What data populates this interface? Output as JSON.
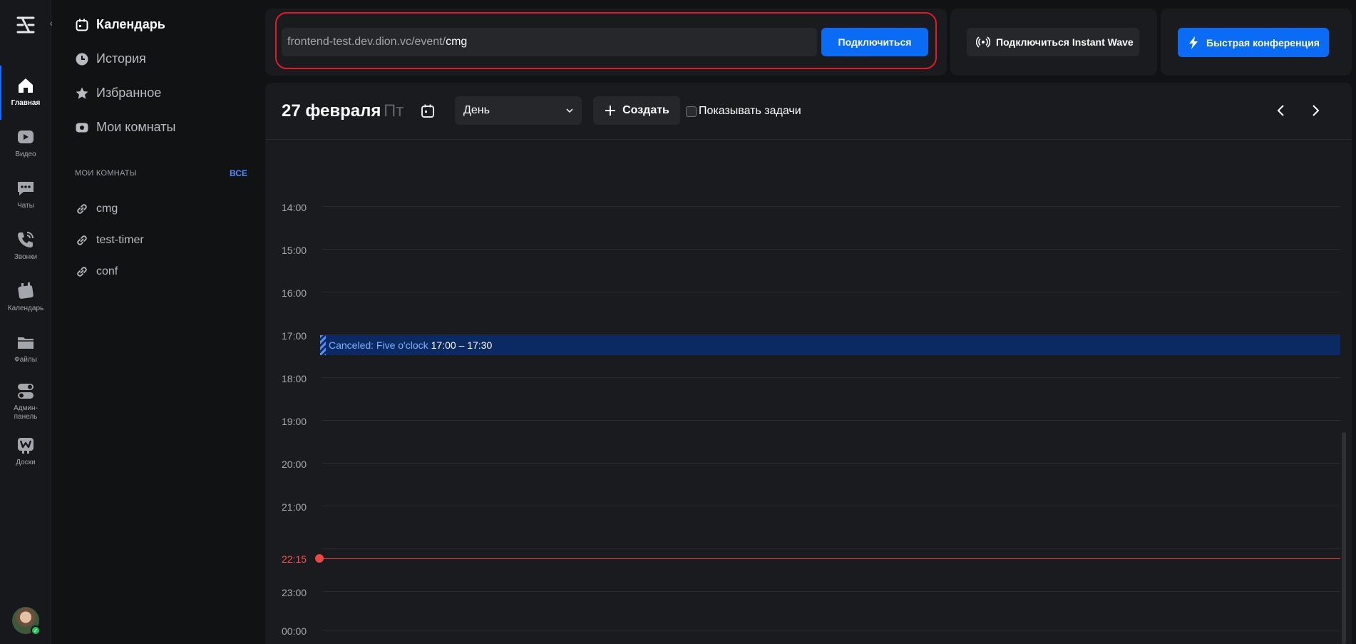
{
  "rail": {
    "items": [
      {
        "label": "Главная",
        "icon": "home-icon"
      },
      {
        "label": "Видео",
        "icon": "video-icon"
      },
      {
        "label": "Чаты",
        "icon": "chat-icon"
      },
      {
        "label": "Звонки",
        "icon": "phone-icon"
      },
      {
        "label": "Календарь",
        "icon": "calendar-icon"
      },
      {
        "label": "Файлы",
        "icon": "folder-icon"
      },
      {
        "label": "Админ-\nпанель",
        "icon": "toggle-icon"
      },
      {
        "label": "Доски",
        "icon": "board-icon"
      }
    ]
  },
  "sidebar": {
    "nav": [
      {
        "label": "Календарь",
        "icon": "calendar-icon"
      },
      {
        "label": "История",
        "icon": "clock-icon"
      },
      {
        "label": "Избранное",
        "icon": "star-icon"
      },
      {
        "label": "Мои комнаты",
        "icon": "camera-icon"
      }
    ],
    "section_title": "МОИ КОМНАТЫ",
    "all_label": "ВСЕ",
    "rooms": [
      "cmg",
      "test-timer",
      "conf"
    ]
  },
  "join": {
    "url_prefix": "frontend-test.dev.dion.vc/event/",
    "url_room": "cmg",
    "connect_label": "Подключиться"
  },
  "wave": {
    "label": "Подключиться Instant Wave"
  },
  "quick": {
    "label": "Быстрая конференция"
  },
  "calendar": {
    "date": "27 февраля",
    "weekday": "Пт",
    "view": "День",
    "create_label": "Создать",
    "tasks_label": "Показывать задачи",
    "hours": [
      "14:00",
      "15:00",
      "16:00",
      "17:00",
      "18:00",
      "19:00",
      "20:00",
      "21:00",
      "23:00",
      "00:00"
    ],
    "now": "22:15",
    "event": {
      "title": "Canceled: Five o'clock",
      "time": "17:00 – 17:30"
    }
  },
  "colors": {
    "accent": "#0a6cf5",
    "highlight_outline": "#e21b2b",
    "now_line": "#ef4444",
    "event_bg": "#0b2a63"
  }
}
